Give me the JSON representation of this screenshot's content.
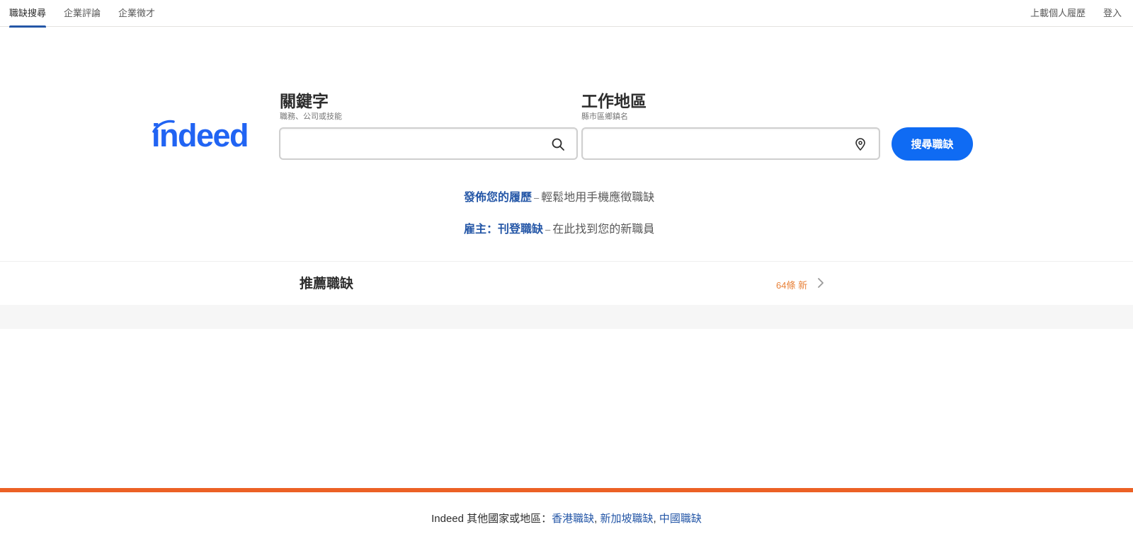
{
  "nav": {
    "tabs": [
      {
        "label": "職缺搜尋",
        "active": true
      },
      {
        "label": "企業評論",
        "active": false
      },
      {
        "label": "企業徵才",
        "active": false
      }
    ],
    "upload_resume": "上載個人履歷",
    "login": "登入"
  },
  "logo": {
    "text": "indeed",
    "color": "#2164f3"
  },
  "search": {
    "keyword_label": "關鍵字",
    "keyword_hint": "職務、公司或技能",
    "keyword_value": "",
    "location_label": "工作地區",
    "location_hint": "縣市區鄉鎮名",
    "location_value": "",
    "button_label": "搜尋職缺",
    "keyword_icon": "search-icon",
    "location_icon": "map-pin-icon"
  },
  "promos": [
    {
      "link": "發佈您的履歷",
      "text": "輕鬆地用手機應徵職缺"
    },
    {
      "link": "雇主：刊登職缺",
      "text": "在此找到您的新職員"
    }
  ],
  "recommended": {
    "title": "推薦職缺",
    "count": "64條 新"
  },
  "footer": {
    "prefix": "Indeed 其他國家或地區：",
    "links": [
      "香港職缺",
      "新加坡職缺",
      "中國職缺"
    ]
  },
  "colors": {
    "brand_blue": "#2164f3",
    "button_blue": "#0f6bf3",
    "link_blue": "#2557a7",
    "accent_orange": "#ec6125",
    "count_orange": "#e8823a"
  }
}
